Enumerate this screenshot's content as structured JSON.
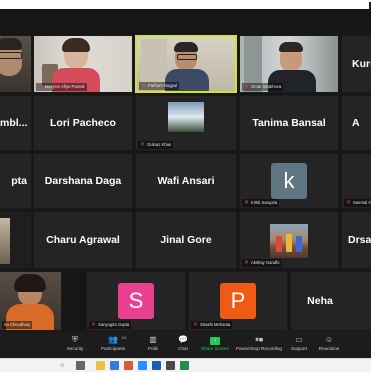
{
  "participants": [
    {
      "name": "",
      "big": "",
      "label": ""
    },
    {
      "name": "Meryem Afiye Pamuk",
      "label": "Meryem Afiye Pamuk"
    },
    {
      "name": "Parham Nagpal",
      "label": "Parham Nagpal"
    },
    {
      "name": "Omar Sirakhova",
      "label": "Omar Sirakhova"
    },
    {
      "big": "Kuru"
    },
    {
      "big": "mbl..."
    },
    {
      "big": "Lori Pacheco"
    },
    {
      "label": "Gulnaz Khan"
    },
    {
      "big": "Tanima Bansal"
    },
    {
      "big": "A"
    },
    {
      "big": "pta"
    },
    {
      "big": "Darshana Daga"
    },
    {
      "big": "Wafi Ansari"
    },
    {
      "label": "Kirtiti Sarupria",
      "avatar": "k"
    },
    {
      "label": "Seemal Gu"
    },
    {
      "big": ""
    },
    {
      "big": "Charu Agrawal"
    },
    {
      "big": "Jinal Gore"
    },
    {
      "label": "Akshay Gandhi"
    },
    {
      "big": "Drsan"
    },
    {
      "label": "na Choudhary"
    },
    {
      "label": "Sanyogita Gupta",
      "avatar": "S"
    },
    {
      "label": "Shashi Mehanta",
      "avatar": "P"
    },
    {
      "big": "Neha"
    }
  ],
  "colors": {
    "avatar_teal": "#5f7582",
    "avatar_pink": "#e9418f",
    "avatar_orange": "#ef5a14",
    "active_border": "#d4e332",
    "mic_muted": "#e8453c",
    "share_green": "#23c85a"
  },
  "toolbar": {
    "security": "Security",
    "participants": "Participants",
    "participants_count": "24",
    "polls": "Polls",
    "chat": "Chat",
    "share_screen": "Share Screen",
    "recording": "Pause/Stop Recording",
    "support": "Support",
    "reactions": "Reactions"
  },
  "icons": {
    "security": "shield-icon",
    "participants": "people-icon",
    "polls": "bar-chart-icon",
    "chat": "chat-bubble-icon",
    "share": "share-screen-icon",
    "record": "record-icon",
    "support": "support-icon",
    "reactions": "smiley-icon"
  }
}
